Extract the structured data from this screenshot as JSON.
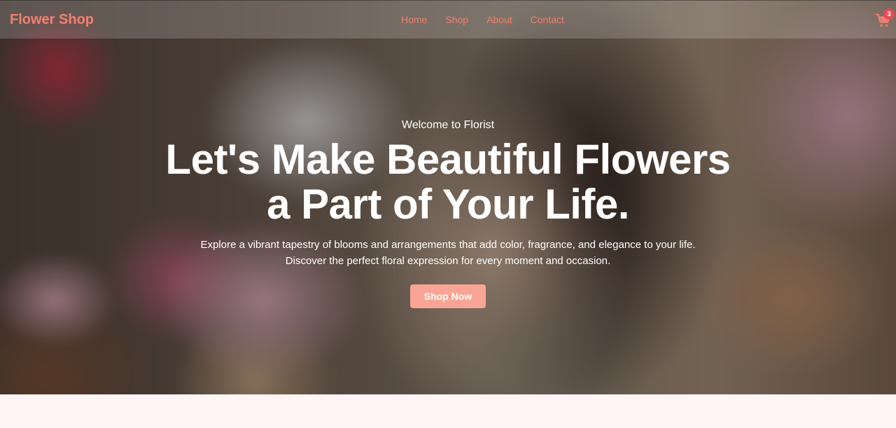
{
  "nav": {
    "brand": "Flower Shop",
    "links": [
      "Home",
      "Shop",
      "About",
      "Contact"
    ],
    "cart_count": "3"
  },
  "hero": {
    "eyebrow": "Welcome to Florist",
    "headline_line1": "Let's Make Beautiful Flowers",
    "headline_line2": "a Part of Your Life.",
    "subtext_line1": "Explore a vibrant tapestry of blooms and arrangements that add color, fragrance, and elegance to your life.",
    "subtext_line2": "Discover the perfect floral expression for every moment and occasion.",
    "cta_label": "Shop Now"
  },
  "colors": {
    "brand": "#f28070",
    "cta": "#f8a595",
    "badge": "#e84b55",
    "page_bg": "#fff5f4"
  },
  "icons": {
    "cart": "shopping-cart-icon"
  }
}
